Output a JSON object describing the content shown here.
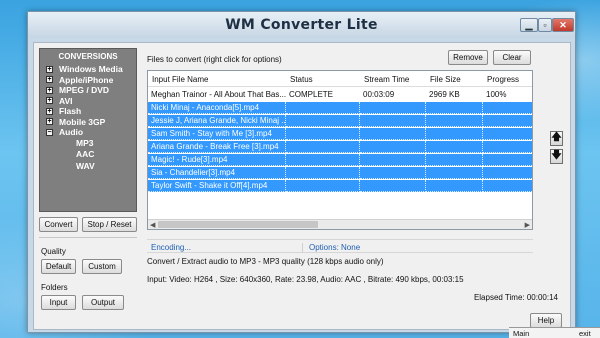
{
  "window": {
    "title": "WM Converter Lite"
  },
  "window_buttons": {
    "min": "▁",
    "max": "▫",
    "close": "✕"
  },
  "conversions": {
    "header": "CONVERSIONS",
    "items": [
      {
        "label": "Windows Media",
        "expander": "+"
      },
      {
        "label": "Apple/iPhone",
        "expander": "+"
      },
      {
        "label": "MPEG / DVD",
        "expander": "+"
      },
      {
        "label": "AVI",
        "expander": "+"
      },
      {
        "label": "Flash",
        "expander": "+"
      },
      {
        "label": "Mobile 3GP",
        "expander": "+"
      },
      {
        "label": "Audio",
        "expander": "−"
      }
    ],
    "audio_children": [
      "MP3",
      "AAC",
      "WAV"
    ]
  },
  "buttons": {
    "convert": "Convert",
    "stop_reset": "Stop / Reset",
    "default": "Default",
    "custom": "Custom",
    "input": "Input",
    "output": "Output",
    "remove": "Remove",
    "clear": "Clear",
    "help": "Help"
  },
  "labels": {
    "quality": "Quality",
    "folders": "Folders",
    "files_to_convert": "Files to convert (right click for options)"
  },
  "table": {
    "columns": [
      "Input File Name",
      "Status",
      "Stream Time",
      "File Size",
      "Progress"
    ],
    "rows": [
      {
        "name": "Meghan Trainor - All About That Bas...",
        "status": "COMPLETE",
        "time": "00:03:09",
        "size": "2969 KB",
        "progress": "100%",
        "selected": false
      },
      {
        "name": "Nicki Minaj - Anaconda[5].mp4",
        "status": "",
        "time": "",
        "size": "",
        "progress": "",
        "selected": true
      },
      {
        "name": "Jessie J, Ariana Grande, Nicki Minaj ...",
        "status": "",
        "time": "",
        "size": "",
        "progress": "",
        "selected": true
      },
      {
        "name": "Sam Smith - Stay with Me [3].mp4",
        "status": "",
        "time": "",
        "size": "",
        "progress": "",
        "selected": true
      },
      {
        "name": "Ariana Grande - Break Free [3].mp4",
        "status": "",
        "time": "",
        "size": "",
        "progress": "",
        "selected": true
      },
      {
        "name": "Magic! - Rude[3].mp4",
        "status": "",
        "time": "",
        "size": "",
        "progress": "",
        "selected": true
      },
      {
        "name": "Sia - Chandelier[3].mp4",
        "status": "",
        "time": "",
        "size": "",
        "progress": "",
        "selected": true
      },
      {
        "name": "Taylor Swift - Shake it Off[4].mp4",
        "status": "",
        "time": "",
        "size": "",
        "progress": "",
        "selected": true
      }
    ]
  },
  "move_buttons": {
    "up": "🡅",
    "down": "🡇"
  },
  "status": {
    "encoding": "Encoding...",
    "options": "Options: None",
    "convert_info": "Convert / Extract audio to MP3 - MP3 quality (128 kbps audio only)",
    "input_info": "Input: Video: H264  , Size: 640x360, Rate: 23.98, Audio: AAC , Bitrate: 490 kbps, 00:03:15",
    "elapsed": "Elapsed Time: 00:00:14"
  },
  "taskbar": {
    "items": [
      "Main",
      "exit"
    ]
  },
  "colors": {
    "selection": "#3399ff",
    "status_text": "#1e5fb3",
    "close_button": "#c1392b"
  }
}
